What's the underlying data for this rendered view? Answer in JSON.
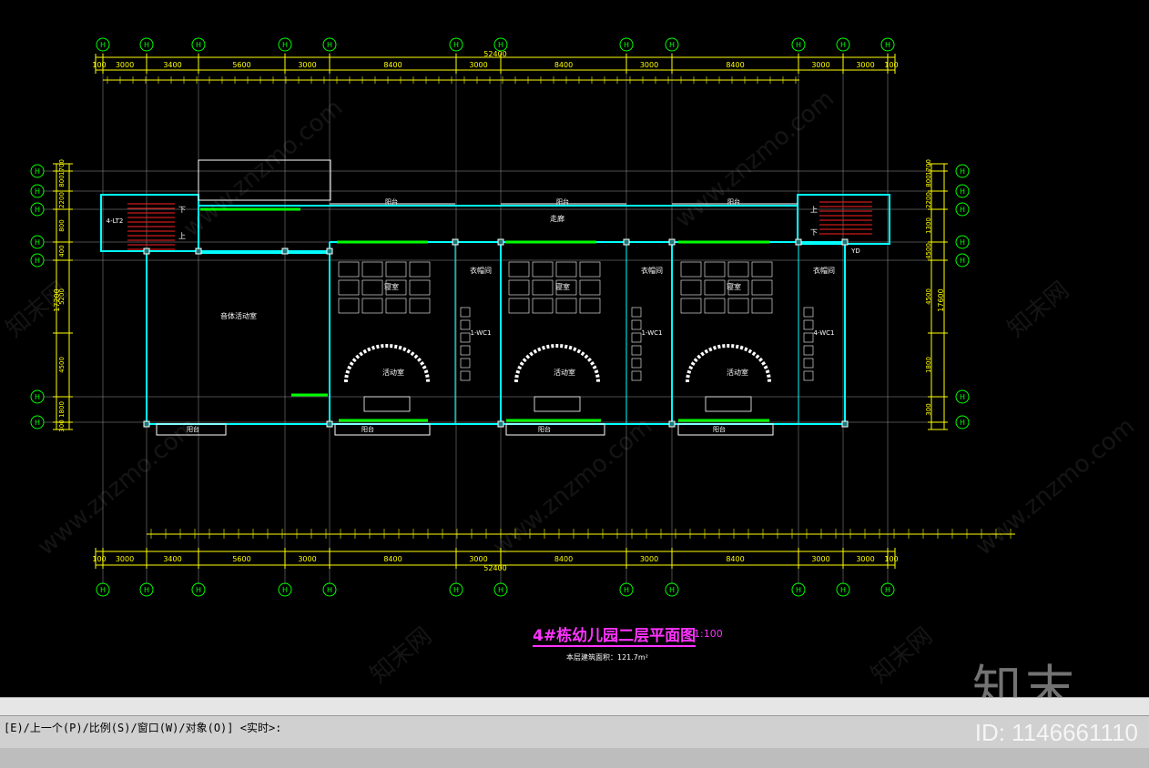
{
  "drawing": {
    "title": "4#栋幼儿园二层平面图",
    "scale": "1:100",
    "area_note": "本层建筑面积：121.7m²",
    "total_dimension": "52400"
  },
  "top_dims": [
    "100",
    "3000",
    "3400",
    "5600",
    "3000",
    "8400",
    "3000",
    "8400",
    "3000",
    "8400",
    "3000",
    "3000",
    "100"
  ],
  "bottom_dims": [
    "100",
    "3000",
    "3400",
    "5600",
    "3000",
    "8400",
    "3000",
    "8400",
    "3000",
    "8400",
    "3000",
    "3000",
    "100"
  ],
  "left_dims": [
    "1700",
    "800",
    "2200",
    "800",
    "400",
    "5200",
    "4500",
    "1800",
    "300"
  ],
  "left_total": "17200",
  "right_dims": [
    "1700",
    "800",
    "2200",
    "1300",
    "4500",
    "4500",
    "1800",
    "300"
  ],
  "right_total": "17600",
  "axis_label": "H",
  "rooms": {
    "corridor": "走廊",
    "music_room": "音体活动室",
    "bedroom": "寝室",
    "activity_room": "活动室",
    "cloakroom": "衣帽间",
    "toilet_1": "1-WC1",
    "toilet_2": "1-WC1",
    "toilet_3": "4-WC1",
    "stair_left": "4-LT2",
    "up": "上",
    "down": "下",
    "balcony": "阳台",
    "yd": "YD"
  },
  "watermarks": [
    "www.znzmo.com",
    "知末网"
  ],
  "logo": "知末",
  "id_text": "ID: 1146661110",
  "command_line": "[E)/上一个(P)/比例(S)/窗口(W)/对象(O)] <实时>:",
  "colors": {
    "axis": "#00ff00",
    "dim": "#ffff00",
    "wall": "#00ffff",
    "window": "#00ff00",
    "stair": "#ff2020",
    "text": "#ffffff",
    "title": "#ff33ff"
  }
}
